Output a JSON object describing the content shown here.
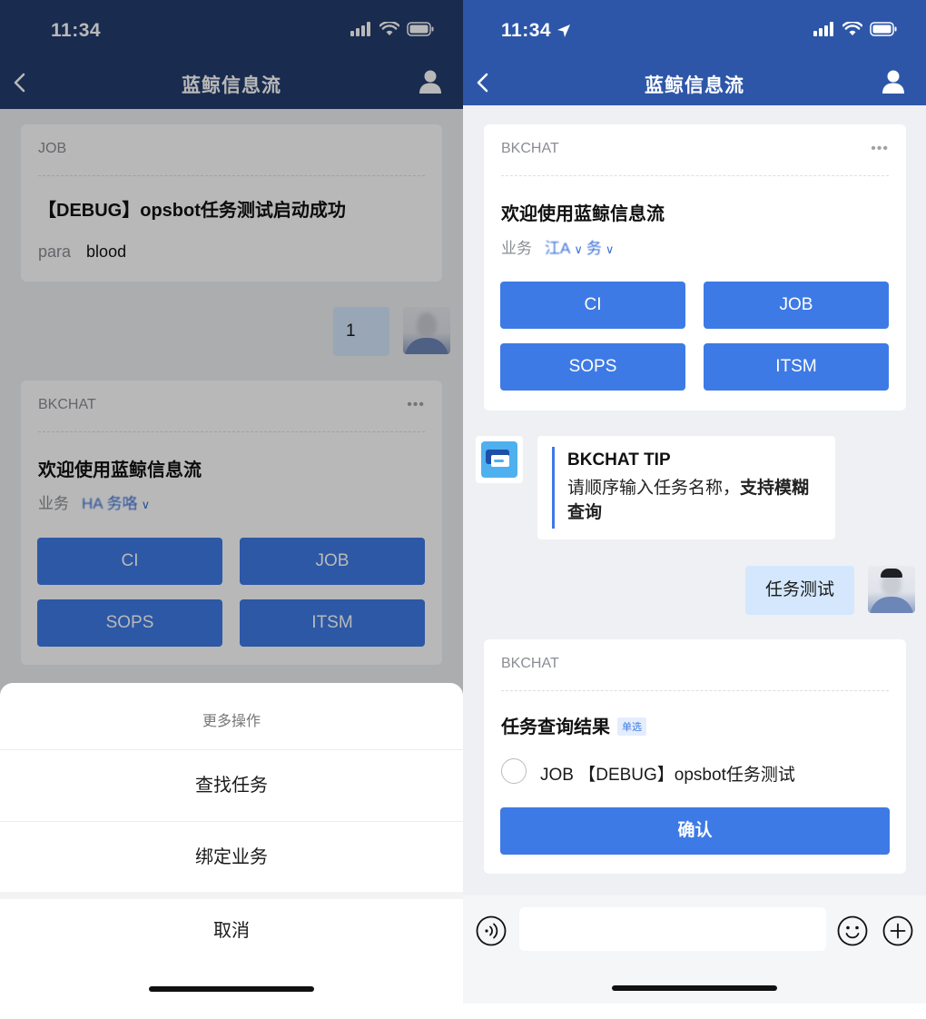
{
  "left": {
    "status": {
      "time": "11:34"
    },
    "nav": {
      "title": "蓝鲸信息流"
    },
    "job_card": {
      "source": "JOB",
      "title": "【DEBUG】opsbot任务测试启动成功",
      "param_key": "para",
      "param_value": "blood"
    },
    "user_message": {
      "text": "1"
    },
    "bkchat_card": {
      "source": "BKCHAT",
      "more": "•••",
      "title": "欢迎使用蓝鲸信息流",
      "biz_label": "业务",
      "biz_value": "HA",
      "biz_value2": "务咯",
      "buttons": [
        "CI",
        "JOB",
        "SOPS",
        "ITSM"
      ]
    },
    "sheet": {
      "title": "更多操作",
      "items": [
        "查找任务",
        "绑定业务"
      ],
      "cancel": "取消"
    }
  },
  "right": {
    "status": {
      "time": "11:34"
    },
    "nav": {
      "title": "蓝鲸信息流"
    },
    "welcome_card": {
      "source": "BKCHAT",
      "more": "•••",
      "title": "欢迎使用蓝鲸信息流",
      "biz_label": "业务",
      "biz_value": "江A",
      "biz_value2": "务",
      "buttons": [
        "CI",
        "JOB",
        "SOPS",
        "ITSM"
      ]
    },
    "tip": {
      "title": "BKCHAT TIP",
      "text_plain": "请顺序输入任务名称，",
      "text_bold": "支持模糊查询"
    },
    "user_message": {
      "text": "任务测试"
    },
    "result_card": {
      "source": "BKCHAT",
      "title": "任务查询结果",
      "tag": "单选",
      "option": "JOB 【DEBUG】opsbot任务测试",
      "confirm": "确认"
    }
  },
  "colors": {
    "nav_left": "#233c6d",
    "nav_right": "#2d56a8",
    "button": "#3d7ae5",
    "bubble": "#d4e7fd",
    "chat_bg": "#eef0f3"
  },
  "icons": [
    "back-chevron-icon",
    "user-icon",
    "signal-icon",
    "wifi-icon",
    "battery-icon",
    "location-arrow-icon",
    "voice-icon",
    "emoji-icon",
    "plus-icon",
    "chat-bot-icon",
    "chevron-down-icon"
  ]
}
